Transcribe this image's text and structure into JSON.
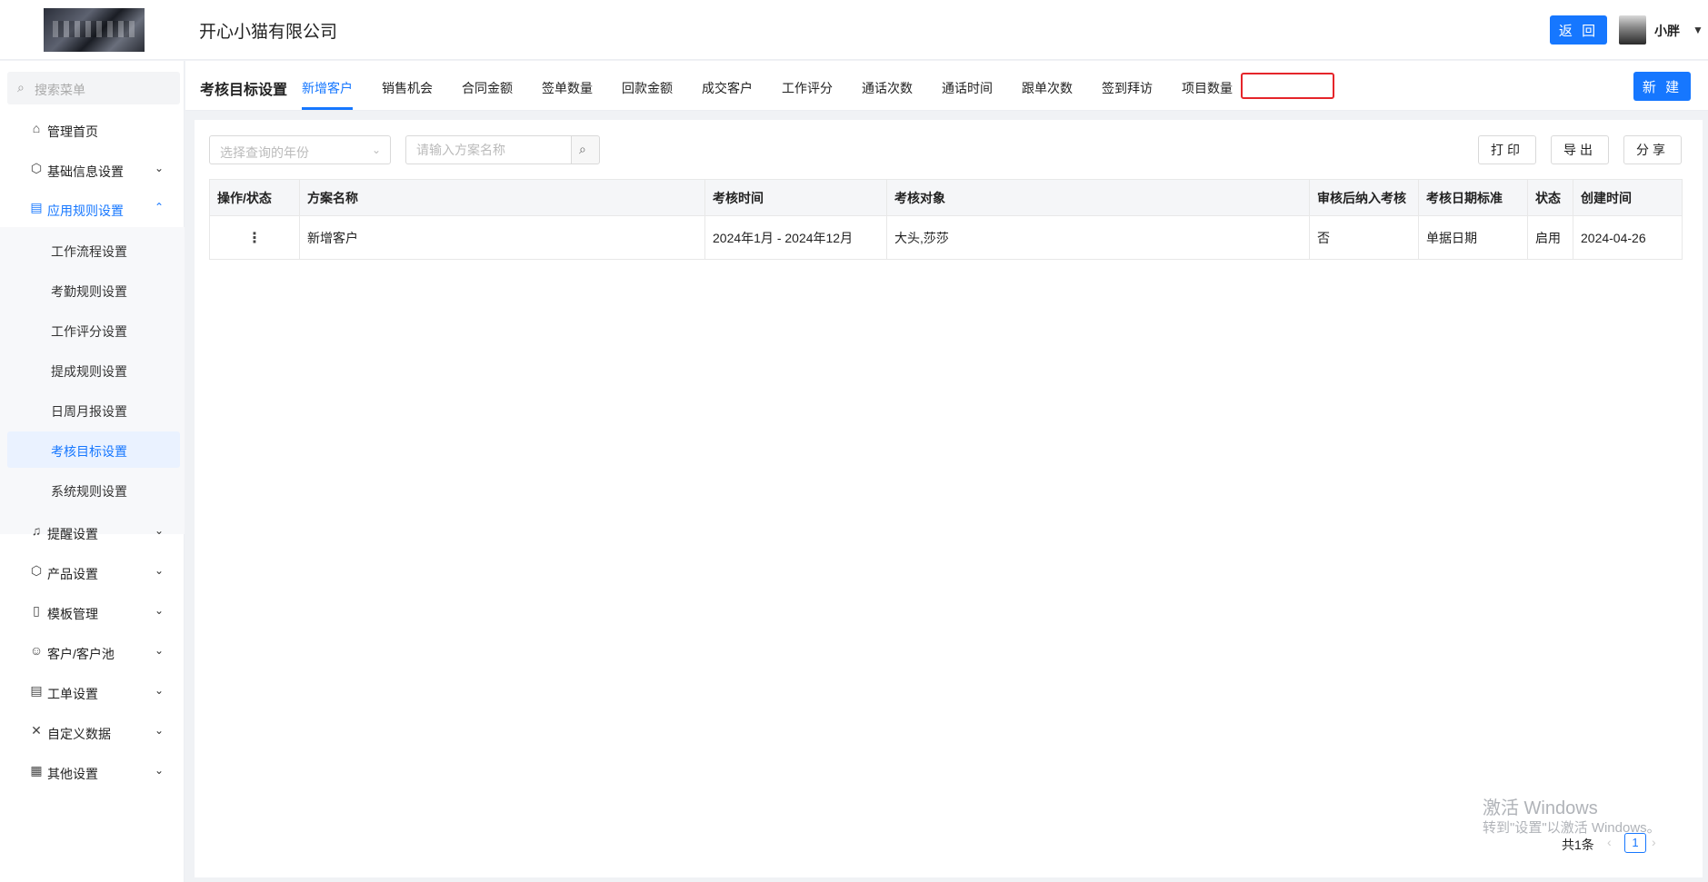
{
  "header": {
    "company": "开心小猫有限公司",
    "back_label": "返 回",
    "username": "小胖"
  },
  "sidebar": {
    "search_placeholder": "搜索菜单",
    "items": [
      {
        "label": "管理首页",
        "icon": "home-icon"
      },
      {
        "label": "基础信息设置",
        "icon": "cube-icon"
      },
      {
        "label": "应用规则设置",
        "icon": "document-icon",
        "expanded": true
      },
      {
        "label": "提醒设置",
        "icon": "bell-icon"
      },
      {
        "label": "产品设置",
        "icon": "box-icon"
      },
      {
        "label": "模板管理",
        "icon": "template-icon"
      },
      {
        "label": "客户/客户池",
        "icon": "user-icon"
      },
      {
        "label": "工单设置",
        "icon": "ticket-icon"
      },
      {
        "label": "自定义数据",
        "icon": "tools-icon"
      },
      {
        "label": "其他设置",
        "icon": "grid-icon"
      }
    ],
    "subitems": [
      "工作流程设置",
      "考勤规则设置",
      "工作评分设置",
      "提成规则设置",
      "日周月报设置",
      "考核目标设置",
      "系统规则设置"
    ],
    "selected_subitem": "考核目标设置"
  },
  "tabbar": {
    "title": "考核目标设置",
    "tabs": [
      "新增客户",
      "销售机会",
      "合同金额",
      "签单数量",
      "回款金额",
      "成交客户",
      "工作评分",
      "通话次数",
      "通话时间",
      "跟单次数",
      "签到拜访",
      "项目数量"
    ],
    "active_tab": "新增客户",
    "new_label": "新 建"
  },
  "filters": {
    "year_placeholder": "选择查询的年份",
    "name_placeholder": "请输入方案名称"
  },
  "toolbar": {
    "print_label": "打印",
    "export_label": "导出",
    "share_label": "分享"
  },
  "table": {
    "columns": [
      "操作/状态",
      "方案名称",
      "考核时间",
      "考核对象",
      "审核后纳入考核",
      "考核日期标准",
      "状态",
      "创建时间"
    ],
    "rows": [
      {
        "ops": "⋮",
        "name": "新增客户",
        "period": "2024年1月 - 2024年12月",
        "target": "大头,莎莎",
        "include_after_review": "否",
        "date_standard": "单据日期",
        "status": "启用",
        "created": "2024-04-26"
      }
    ]
  },
  "pagination": {
    "total": "共1条",
    "current_page": "1"
  },
  "watermark": {
    "line1": "激活 Windows",
    "line2": "转到\"设置\"以激活 Windows。"
  },
  "colors": {
    "accent": "#1677ff",
    "highlight_border": "#e5252a"
  }
}
